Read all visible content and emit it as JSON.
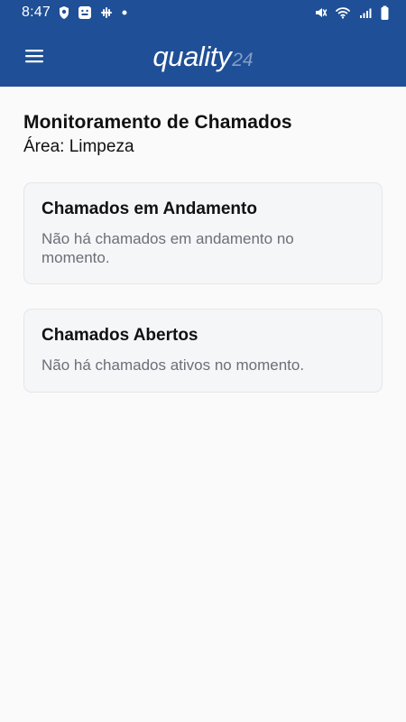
{
  "status_bar": {
    "time": "8:47",
    "icons_left": [
      "shield-icon",
      "teams-icon",
      "slack-icon",
      "notification-dot-icon"
    ],
    "icons_right": [
      "mute-icon",
      "wifi-icon",
      "signal-icon",
      "battery-icon"
    ]
  },
  "header": {
    "logo_text": "quality",
    "logo_mark": "24",
    "background_color": "#1f4f96"
  },
  "page": {
    "title": "Monitoramento de Chamados",
    "subtitle": "Área: Limpeza"
  },
  "cards": [
    {
      "title": "Chamados em Andamento",
      "message": "Não há chamados em andamento no momento."
    },
    {
      "title": "Chamados Abertos",
      "message": "Não há chamados ativos no momento."
    }
  ]
}
